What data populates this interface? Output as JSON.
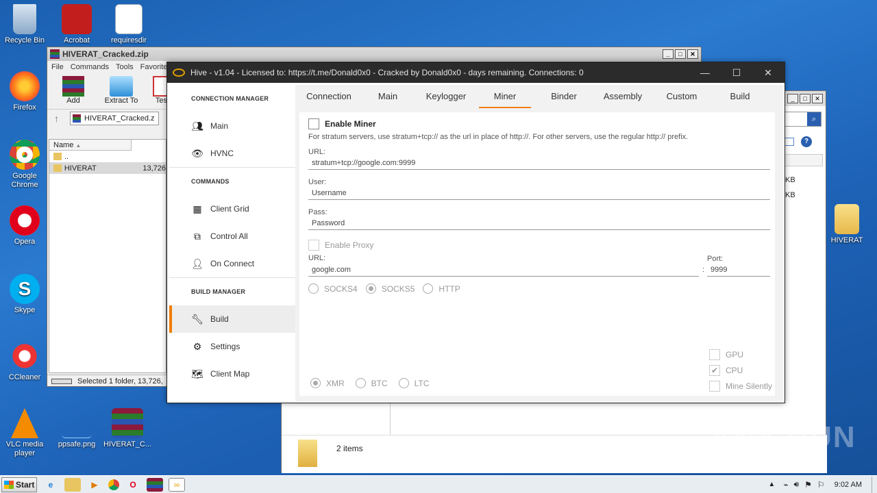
{
  "desktop": {
    "icons_left": [
      "Recycle Bin",
      "Firefox",
      "Google Chrome",
      "Opera",
      "Skype",
      "CCleaner",
      "VLC media player"
    ],
    "icons_top": [
      "Acrobat",
      "requiresdir"
    ],
    "icons_bottom": [
      "ppsafe.png",
      "HIVERAT_C..."
    ],
    "icon_right": "HIVERAT"
  },
  "winrar": {
    "title": "HIVERAT_Cracked.zip",
    "menu": [
      "File",
      "Commands",
      "Tools",
      "Favorite"
    ],
    "toolbar": [
      "Add",
      "Extract To",
      "Test"
    ],
    "path": "HIVERAT_Cracked.z",
    "col_name": "Name",
    "rows": [
      {
        "name": "..",
        "size": ""
      },
      {
        "name": "HIVERAT",
        "size": "13,726"
      }
    ],
    "status": "Selected 1 folder, 13,726,"
  },
  "explorer": {
    "items_count": "2 items",
    "sizes": [
      "KB",
      "KB"
    ]
  },
  "hive": {
    "title": "Hive - v1.04 - Licensed to: https://t.me/Donald0x0 -  Cracked by Donald0x0 - days remaining. Connections: 0",
    "sidebar": {
      "connection_manager": "CONNECTION MANAGER",
      "main": "Main",
      "hvnc": "HVNC",
      "commands": "COMMANDS",
      "client_grid": "Client Grid",
      "control_all": "Control All",
      "on_connect": "On Connect",
      "build_manager": "BUILD MANAGER",
      "build": "Build",
      "settings": "Settings",
      "client_map": "Client Map"
    },
    "tabs": [
      "Connection",
      "Main",
      "Keylogger",
      "Miner",
      "Binder",
      "Assembly",
      "Custom",
      "Build"
    ],
    "active_tab": "Miner",
    "miner": {
      "enable_miner": "Enable Miner",
      "note": "For stratum servers, use stratum+tcp:// as the url in place of http://. For other servers, use the regular http:// prefix.",
      "url_label": "URL:",
      "url_value": "stratum+tcp://google.com:9999",
      "user_label": "User:",
      "user_value": "Username",
      "pass_label": "Pass:",
      "pass_value": "Password",
      "enable_proxy": "Enable Proxy",
      "proxy_url_label": "URL:",
      "proxy_url_value": "google.com",
      "port_label": "Port:",
      "port_sep": ":",
      "port_value": "9999",
      "proxy_types": [
        "SOCKS4",
        "SOCKS5",
        "HTTP"
      ],
      "coins": [
        "XMR",
        "BTC",
        "LTC"
      ],
      "gpu": "GPU",
      "cpu": "CPU",
      "mine_silently": "Mine Silently"
    }
  },
  "taskbar": {
    "start": "Start",
    "clock": "9:02 AM"
  },
  "watermark": "ANY RUN"
}
